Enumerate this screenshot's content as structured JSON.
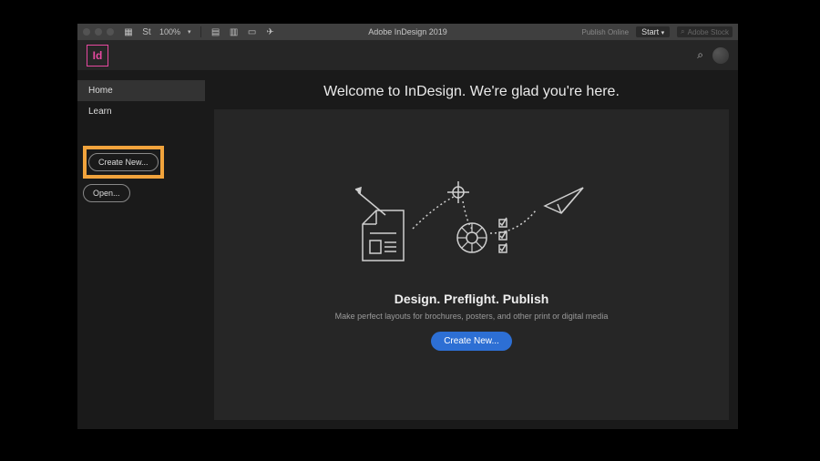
{
  "titlebar": {
    "app_title": "Adobe InDesign 2019",
    "zoom": "100%",
    "publish": "Publish Online",
    "start": "Start",
    "stock_placeholder": "Adobe Stock"
  },
  "logo": {
    "id_text": "Id"
  },
  "sidebar": {
    "home": "Home",
    "learn": "Learn",
    "create_new": "Create New...",
    "open": "Open..."
  },
  "welcome": {
    "heading": "Welcome to InDesign. We're glad you're here."
  },
  "hero": {
    "title": "Design. Preflight. Publish",
    "subtitle": "Make perfect layouts for brochures, posters, and other print or digital media",
    "cta": "Create New..."
  }
}
